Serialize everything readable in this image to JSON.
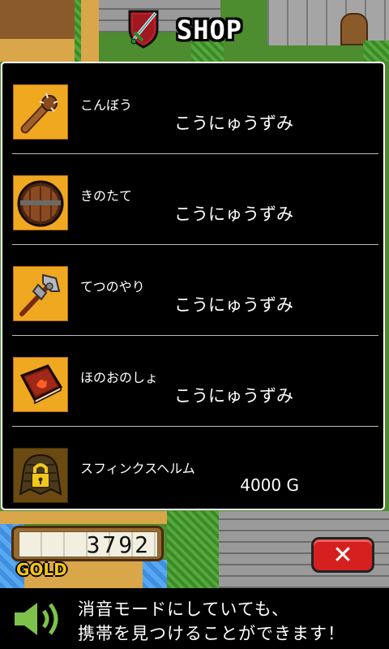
{
  "header": {
    "title": "SHOP"
  },
  "items": [
    {
      "name": "こんぼう",
      "status": "こうにゅうずみ",
      "icon": "club-icon"
    },
    {
      "name": "きのたて",
      "status": "こうにゅうずみ",
      "icon": "wooden-shield-icon"
    },
    {
      "name": "てつのやり",
      "status": "こうにゅうずみ",
      "icon": "iron-spear-icon"
    },
    {
      "name": "ほのおのしょ",
      "status": "こうにゅうずみ",
      "icon": "fire-book-icon"
    },
    {
      "name": "スフィンクスヘルム",
      "price": "4000 G",
      "icon": "locked-helm-icon"
    }
  ],
  "wallet": {
    "amount": "3792",
    "label": "GOLD"
  },
  "close": {
    "label": "✕"
  },
  "ad": {
    "line1": "消音モードにしていても、",
    "line2": "携帯を見つけることができます！"
  },
  "colors": {
    "panel": "#000000",
    "icon_bg": "#f0a820",
    "close": "#d62020",
    "gold": "#f5c518"
  }
}
